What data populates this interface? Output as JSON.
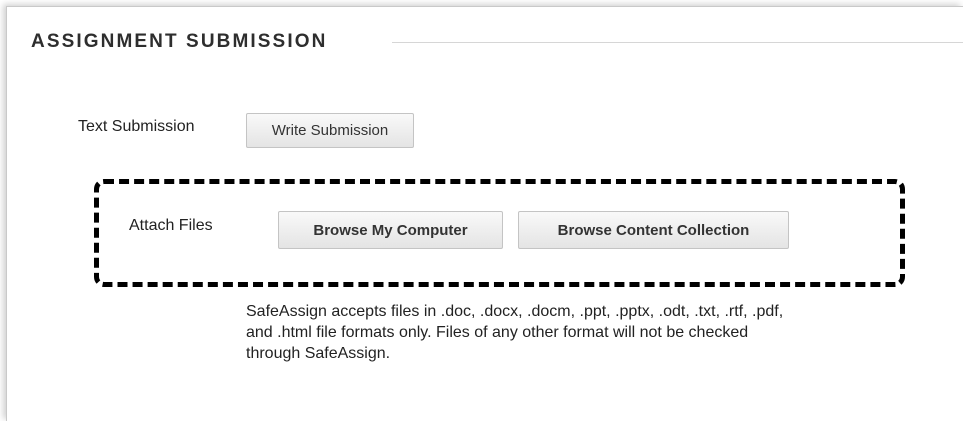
{
  "section": {
    "title": "ASSIGNMENT SUBMISSION"
  },
  "text_submission": {
    "label": "Text Submission",
    "button_label": "Write Submission"
  },
  "attach_files": {
    "label": "Attach Files",
    "browse_computer_label": "Browse My Computer",
    "browse_collection_label": "Browse Content Collection"
  },
  "safeassign_note": {
    "lines": [
      "SafeAssign accepts files in .doc, .docx, .docm, .ppt, .pptx, .odt, .txt, .rtf, .pdf,",
      "and .html file formats only. Files of any other format will not be checked",
      "through SafeAssign."
    ]
  },
  "colors": {
    "highlight_border": "#000000",
    "button_face": "#ececec",
    "text": "#222222"
  }
}
